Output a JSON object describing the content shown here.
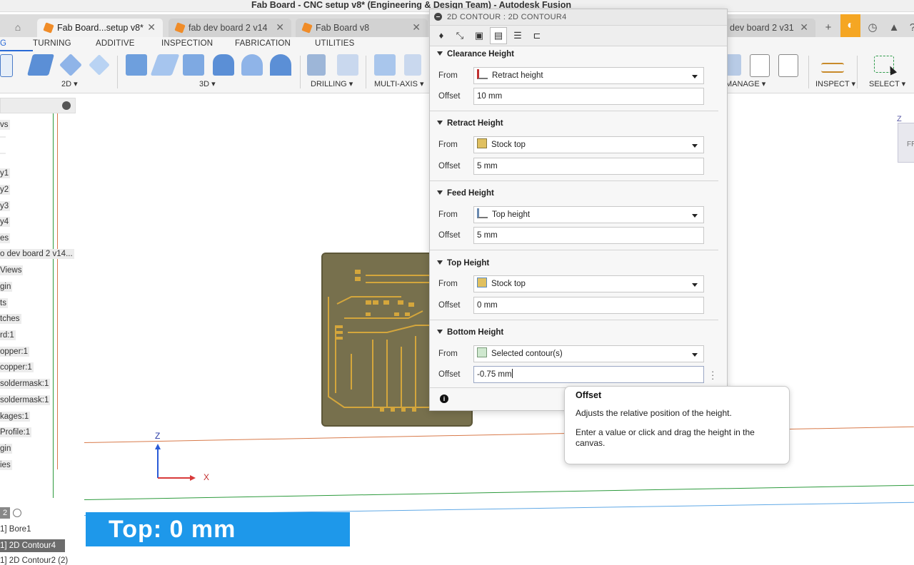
{
  "window": {
    "title": "Fab Board - CNC setup v8* (Engineering & Design Team) - Autodesk Fusion"
  },
  "tabs": [
    {
      "label": "Fab Board...setup v8*",
      "active": true
    },
    {
      "label": "fab dev board 2 v14",
      "active": false
    },
    {
      "label": "Fab Board v8",
      "active": false
    },
    {
      "label": "dev board 2 v31",
      "active": false
    }
  ],
  "ribbon": {
    "tabs": [
      "G",
      "TURNING",
      "ADDITIVE",
      "INSPECTION",
      "FABRICATION",
      "UTILITIES"
    ],
    "groups": {
      "g2d": "2D",
      "g3d": "3D",
      "drilling": "DRILLING",
      "multiaxis": "MULTI-AXIS",
      "manage": "MANAGE",
      "inspect": "INSPECT",
      "select": "SELECT"
    }
  },
  "browser": {
    "items": [
      "vs",
      "",
      "",
      "y1",
      "y2",
      "y3",
      "y4",
      "es",
      "o dev board 2 v14...",
      "Views",
      "gin",
      "ts",
      "tches",
      "rd:1",
      "opper:1",
      "copper:1",
      "soldermask:1",
      "soldermask:1",
      "kages:1",
      "Profile:1",
      "gin",
      "ies"
    ],
    "ops": [
      "2",
      "1] Bore1",
      "1] 2D Contour4",
      "1] 2D Contour2 (2)"
    ]
  },
  "canvas": {
    "top_label": "Top: 0 mm",
    "axis_z": "Z",
    "axis_x": "X",
    "viewcube_z": "Z",
    "viewcube_face": "FR"
  },
  "panel": {
    "header": "2D CONTOUR : 2D CONTOUR4",
    "from_label": "From",
    "offset_label": "Offset",
    "sections": [
      {
        "title": "Clearance Height",
        "from": "Retract height",
        "offset": "10 mm"
      },
      {
        "title": "Retract Height",
        "from": "Stock top",
        "offset": "5 mm"
      },
      {
        "title": "Feed Height",
        "from": "Top height",
        "offset": "5 mm"
      },
      {
        "title": "Top Height",
        "from": "Stock top",
        "offset": "0 mm"
      },
      {
        "title": "Bottom Height",
        "from": "Selected contour(s)",
        "offset": "-0.75 mm"
      }
    ]
  },
  "tooltip": {
    "title": "Offset",
    "line1": "Adjusts the relative position of the height.",
    "line2": "Enter a value or click and drag the height in the canvas."
  },
  "colors": {
    "accent": "#1e98ea",
    "orange": "#f5a623",
    "board": "#77704d",
    "trace": "#d4a63c"
  }
}
